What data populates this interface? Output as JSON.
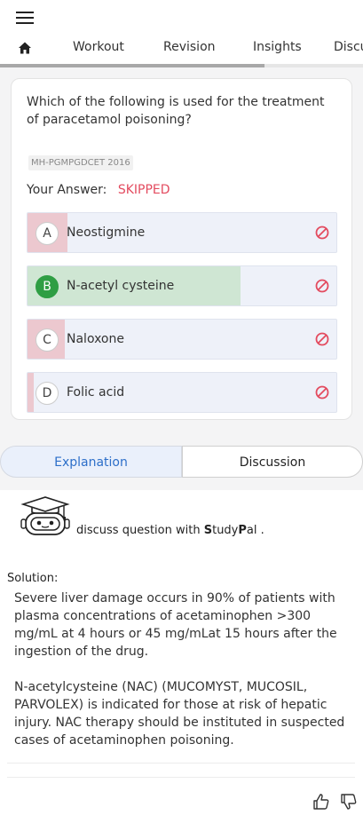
{
  "nav": {
    "tabs": [
      {
        "label": "Workout"
      },
      {
        "label": "Revision"
      },
      {
        "label": "Insights"
      },
      {
        "label": "Discu"
      }
    ],
    "active_tab": "home"
  },
  "question": {
    "text": "Which of the following is used for the treatment of paracetamol poisoning?",
    "tag": "MH-PGMPGDCET 2016",
    "answer_label": "Your Answer:",
    "answer_value": "SKIPPED",
    "options": [
      {
        "letter": "A",
        "text": "Neostigmine",
        "percent": 0.13,
        "fill_color": "#ecc8cf",
        "correct": false
      },
      {
        "letter": "B",
        "text": "N-acetyl cysteine",
        "percent": 0.69,
        "fill_color": "#cfe6d3",
        "correct": true
      },
      {
        "letter": "C",
        "text": "Naloxone",
        "percent": 0.12,
        "fill_color": "#ecc8cf",
        "correct": false
      },
      {
        "letter": "D",
        "text": "Folic acid",
        "percent": 0.02,
        "fill_color": "#ecc8cf",
        "correct": false
      }
    ]
  },
  "segments": {
    "explanation": "Explanation",
    "discussion": "Discussion",
    "active": "explanation"
  },
  "studypal": {
    "prefix": "discuss question with ",
    "brand_s": "S",
    "brand_tudy": "tudy",
    "brand_p": "P",
    "brand_al": "al ."
  },
  "solution": {
    "title": "Solution:",
    "p1": "Severe liver damage occurs in 90% of patients with plasma concentrations of acetaminophen >300 mg/mL at 4 hours or 45 mg/mLat 15 hours after the ingestion of the drug.",
    "p2": "N-acetylcysteine (NAC) (MUCOMYST, MUCOSIL, PARVOLEX) is indicated for those at risk of hepatic injury. NAC therapy should be instituted in suspected cases of acetaminophen poisoning."
  },
  "colors": {
    "skipped": "#e34b5f",
    "correct_green": "#2f9e44",
    "accent_blue": "#2d6fc9",
    "ban_red": "#e34b5f"
  }
}
